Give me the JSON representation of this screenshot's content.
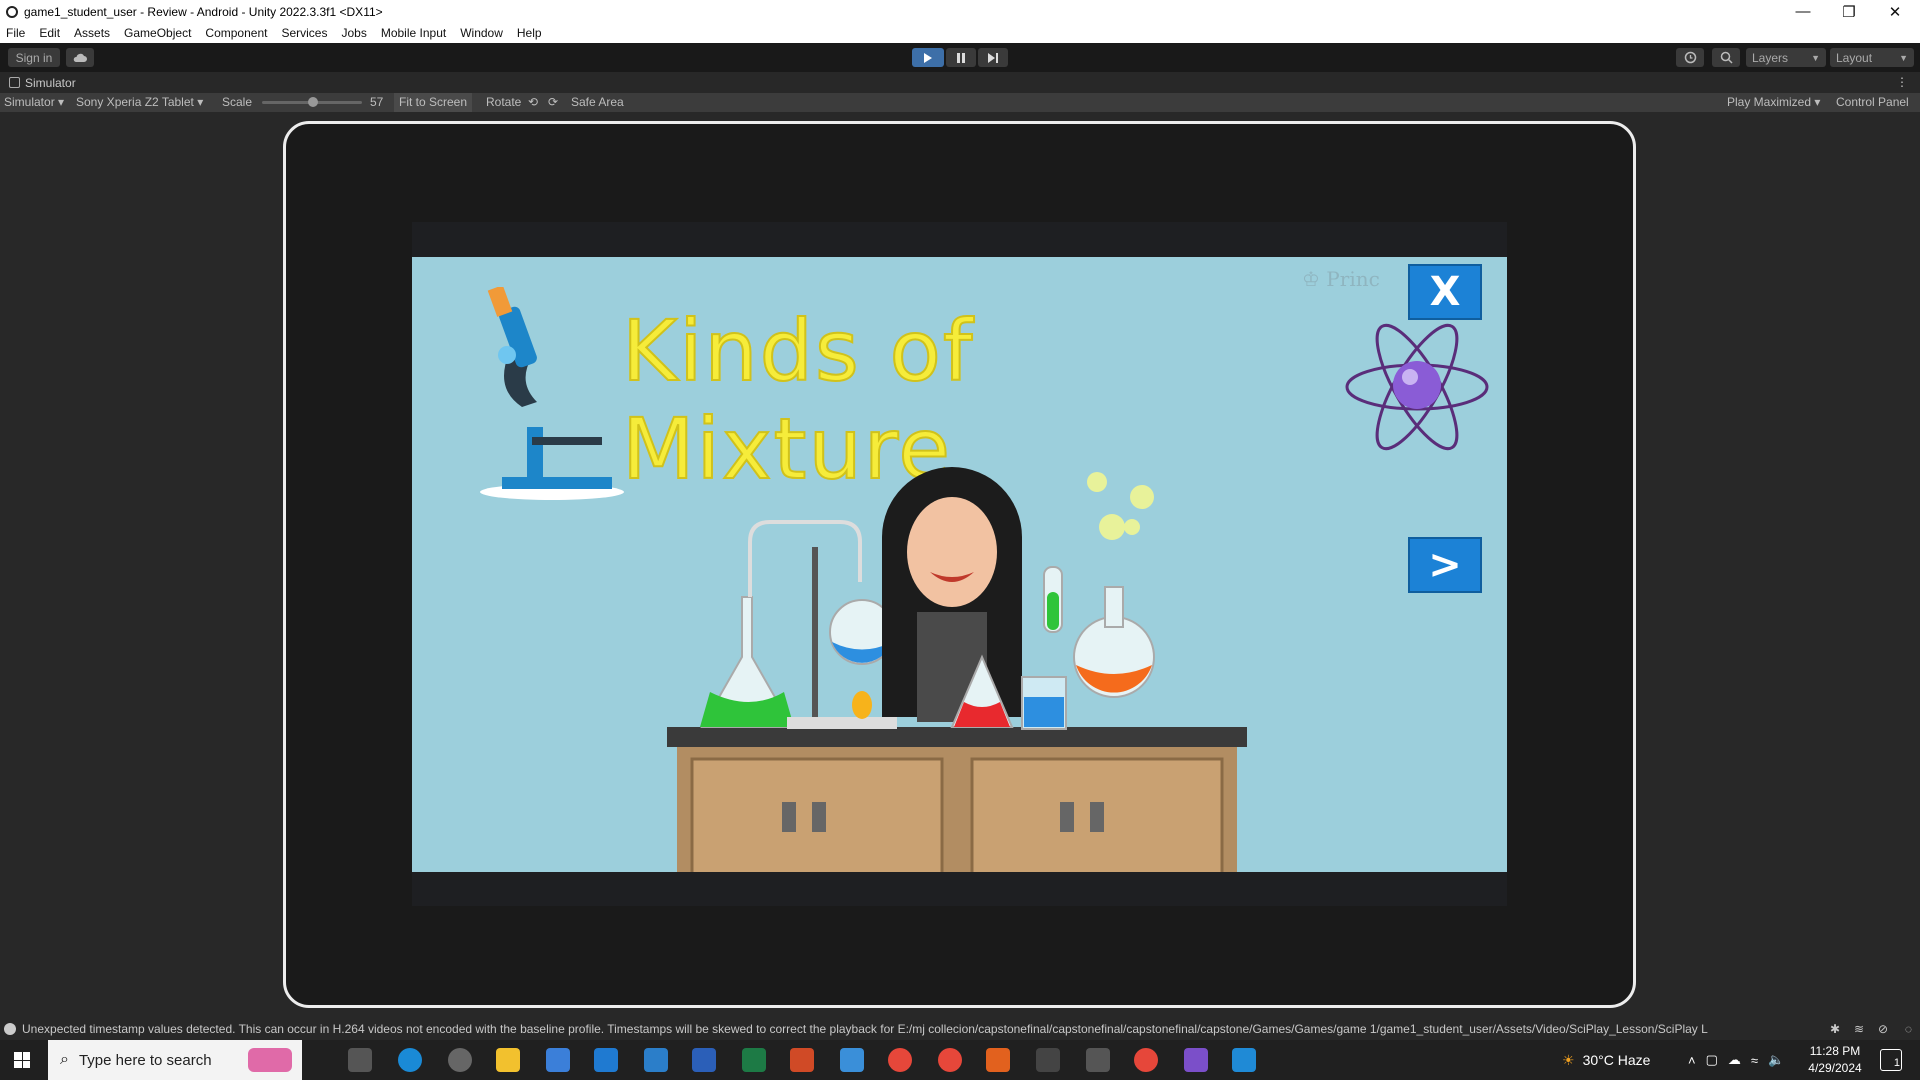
{
  "window": {
    "title": "game1_student_user - Review - Android - Unity 2022.3.3f1 <DX11>",
    "controls": {
      "minimize": "—",
      "restore": "❐",
      "close": "✕"
    }
  },
  "menu": [
    "File",
    "Edit",
    "Assets",
    "GameObject",
    "Component",
    "Services",
    "Jobs",
    "Mobile Input",
    "Window",
    "Help"
  ],
  "toolbar": {
    "sign_in": "Sign in",
    "layers": "Layers",
    "layout": "Layout"
  },
  "simulator_tab": {
    "title": "Simulator"
  },
  "simulator_bar": {
    "mode": "Simulator",
    "device": "Sony Xperia Z2 Tablet",
    "scale_label": "Scale",
    "scale_value": "57",
    "fit_to_screen": "Fit to Screen",
    "rotate_label": "Rotate",
    "safe_area": "Safe Area",
    "play_mode": "Play Maximized",
    "control_panel": "Control Panel"
  },
  "game": {
    "title": "Kinds of Mixture",
    "watermark": "Princ",
    "close_button": "X",
    "next_button": ">"
  },
  "status": {
    "message": "Unexpected timestamp values detected. This can occur in H.264 videos not encoded with the baseline profile. Timestamps will be skewed to correct the playback for E:/mj collecion/capstonefinal/capstonefinal/capstonefinal/capstone/Games/Games/game 1/game1_student_user/Assets/Video/SciPlay_Lesson/SciPlay L"
  },
  "taskbar": {
    "search_placeholder": "Type here to search",
    "weather": "30°C  Haze",
    "time": "11:28 PM",
    "date": "4/29/2024",
    "notifications": "1"
  },
  "colors": {
    "game_bg": "#9ccfdc",
    "title_yellow": "#f6ec3a",
    "button_blue": "#1c82d6"
  }
}
